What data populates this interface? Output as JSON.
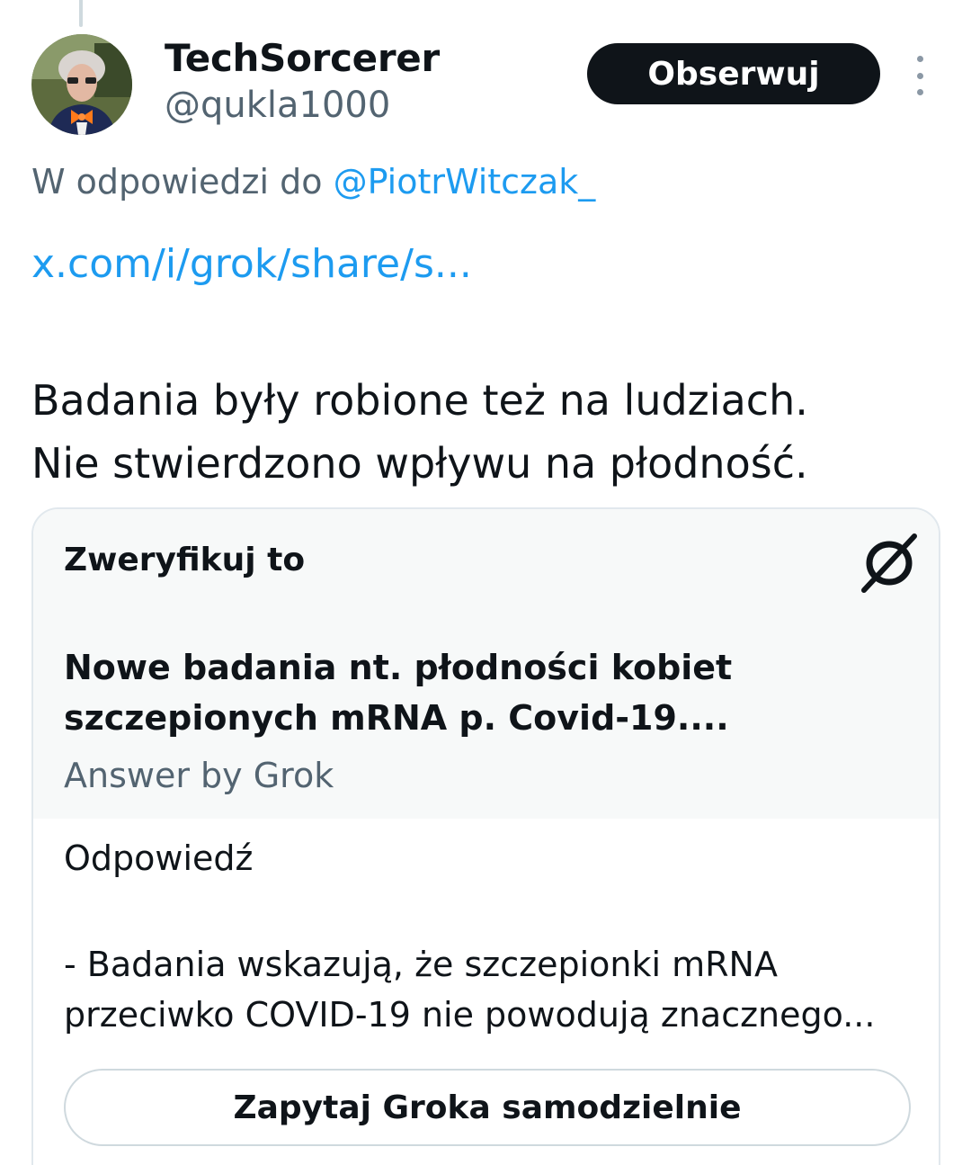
{
  "user": {
    "name": "TechSorcerer",
    "handle": "@qukla1000"
  },
  "header": {
    "follow_label": "Obserwuj"
  },
  "reply": {
    "prefix": "W odpowiedzi do ",
    "mention": "@PiotrWitczak_"
  },
  "tweet": {
    "link": "x.com/i/grok/share/s...",
    "text_line1": "Badania były robione też na ludziach.",
    "text_line2": "Nie stwierdzono wpływu na płodność."
  },
  "grok_card": {
    "verify_label": "Zweryfikuj to",
    "title_line1": "Nowe badania nt. płodności kobiet",
    "title_line2": "szczepionych mRNA p. Covid-19....",
    "answer_by": "Answer by Grok",
    "answer_label": "Odpowiedź",
    "answer_line1": "- Badania wskazują, że szczepionki mRNA",
    "answer_line2": "przeciwko COVID-19 nie powodują znacznego...",
    "ask_button": "Zapytaj Groka samodzielnie"
  },
  "colors": {
    "accent_link": "#1d9bf0",
    "secondary_text": "#536471",
    "button_dark": "#0f1419",
    "card_header_bg": "#f7f9f9"
  },
  "icons": {
    "more": "vertical-dots-icon",
    "grok": "grok-logo-icon"
  }
}
